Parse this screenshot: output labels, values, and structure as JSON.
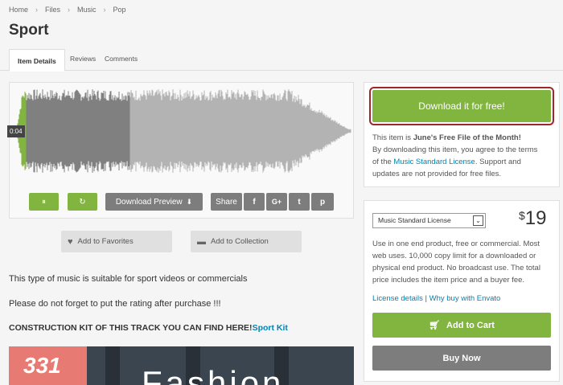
{
  "breadcrumb": {
    "items": [
      "Home",
      "Files",
      "Music",
      "Pop"
    ]
  },
  "page": {
    "title": "Sport"
  },
  "tabs": [
    {
      "label": "Item Details",
      "active": true
    },
    {
      "label": "Reviews"
    },
    {
      "label": "Comments"
    }
  ],
  "player": {
    "time": "0:04",
    "played_fraction": 0.03,
    "buffered_fraction": 0.34,
    "controls": {
      "pause_icon": "pause-icon",
      "restart_icon": "restart-icon",
      "download_preview_label": "Download Preview",
      "share_label": "Share",
      "share_targets": [
        {
          "name": "facebook",
          "glyph": "f"
        },
        {
          "name": "google-plus",
          "glyph": "G+"
        },
        {
          "name": "twitter",
          "glyph": "t"
        },
        {
          "name": "pinterest",
          "glyph": "p"
        }
      ]
    }
  },
  "actions": {
    "favorites_label": "Add to Favorites",
    "collection_label": "Add to Collection"
  },
  "description": {
    "line1": "This type of music is suitable for sport videos or commercials",
    "line2": "Please do not forget to put the rating after purchase !!!",
    "line3_text": "CONSTRUCTION KIT OF THIS TRACK YOU CAN FIND HERE!",
    "line3_link": "Sport Kit"
  },
  "banner": {
    "number": "331",
    "word": "Fashion"
  },
  "free_box": {
    "download_label": "Download it for free!",
    "text_prefix": "This item is ",
    "text_bold": "June's Free File of the Month!",
    "text_line2": "By downloading this item, you agree to the terms",
    "text_of": "of the ",
    "license_link": "Music Standard License",
    "text_suffix": ". Support and",
    "text_line4": "updates are not provided for free files."
  },
  "purchase_box": {
    "license_select": "Music Standard License",
    "currency": "$",
    "price": "19",
    "license_desc_lines": [
      "Use in one end product, free or commercial. Most",
      "web uses. 10,000 copy limit for a downloaded or",
      "physical end product. No broadcast use. The total",
      "price includes the item price and a buyer fee."
    ],
    "license_details_link": "License details",
    "separator": " | ",
    "why_envato_link": "Why buy with Envato",
    "add_to_cart_label": "Add to Cart",
    "buy_now_label": "Buy Now"
  },
  "colors": {
    "accent_green": "#82b440",
    "button_gray": "#7d7d7d",
    "link_blue": "#0084b4",
    "focus_red": "#a1262b"
  }
}
